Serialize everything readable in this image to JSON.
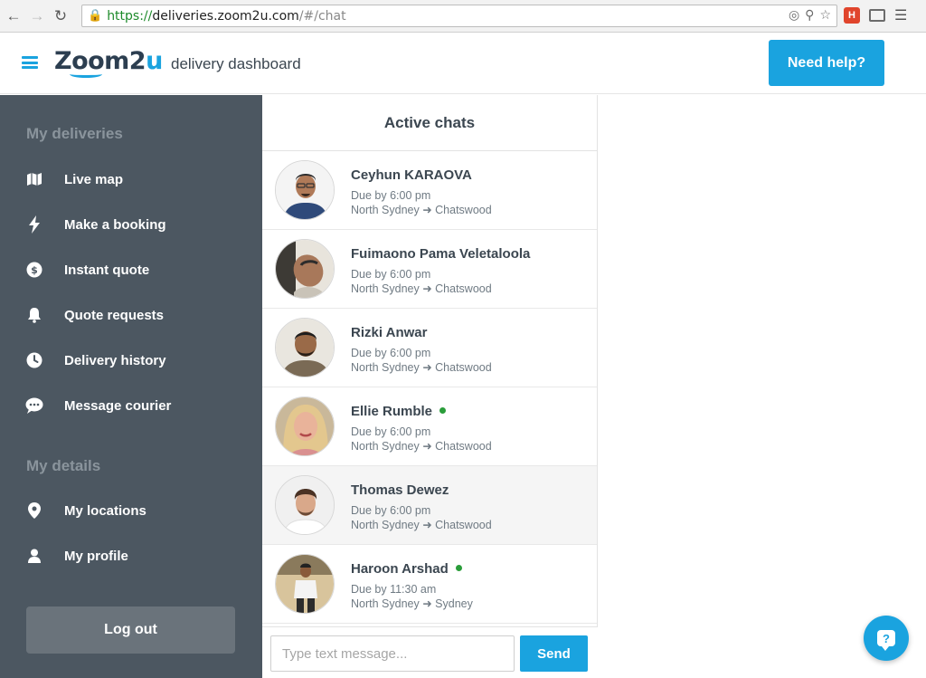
{
  "browser": {
    "url_scheme": "https://",
    "url_host": "deliveries.zoom2u.com",
    "url_path": "/#/chat"
  },
  "header": {
    "logo_main": "Zoom2",
    "logo_accent": "u",
    "subtitle": "delivery dashboard",
    "help_label": "Need help?"
  },
  "sidebar": {
    "section_deliveries": "My deliveries",
    "deliveries_items": [
      {
        "label": "Live map",
        "icon": "map-icon"
      },
      {
        "label": "Make a booking",
        "icon": "lightning-icon"
      },
      {
        "label": "Instant quote",
        "icon": "dollar-icon"
      },
      {
        "label": "Quote requests",
        "icon": "bell-icon"
      },
      {
        "label": "Delivery history",
        "icon": "clock-icon"
      },
      {
        "label": "Message courier",
        "icon": "chat-bubble-icon"
      }
    ],
    "section_details": "My details",
    "details_items": [
      {
        "label": "My locations",
        "icon": "location-pin-icon"
      },
      {
        "label": "My profile",
        "icon": "user-icon"
      }
    ],
    "logout_label": "Log out"
  },
  "chats": {
    "title": "Active chats",
    "items": [
      {
        "name": "Ceyhun KARAOVA",
        "due": "Due by 6:00 pm",
        "route": "North Sydney ➜ Chatswood",
        "online": false
      },
      {
        "name": "Fuimaono Pama Veletaloola",
        "due": "Due by 6:00 pm",
        "route": "North Sydney ➜ Chatswood",
        "online": false
      },
      {
        "name": "Rizki Anwar",
        "due": "Due by 6:00 pm",
        "route": "North Sydney ➜ Chatswood",
        "online": false
      },
      {
        "name": "Ellie Rumble",
        "due": "Due by 6:00 pm",
        "route": "North Sydney ➜ Chatswood",
        "online": true
      },
      {
        "name": "Thomas Dewez",
        "due": "Due by 6:00 pm",
        "route": "North Sydney ➜ Chatswood",
        "online": false,
        "selected": true
      },
      {
        "name": "Haroon Arshad",
        "due": "Due by 11:30 am",
        "route": "North Sydney ➜ Sydney",
        "online": true
      }
    ],
    "input_placeholder": "Type text message...",
    "send_label": "Send"
  },
  "colors": {
    "accent": "#1aa3df",
    "sidebar_bg": "#4c5761",
    "online": "#2a9d3a"
  }
}
